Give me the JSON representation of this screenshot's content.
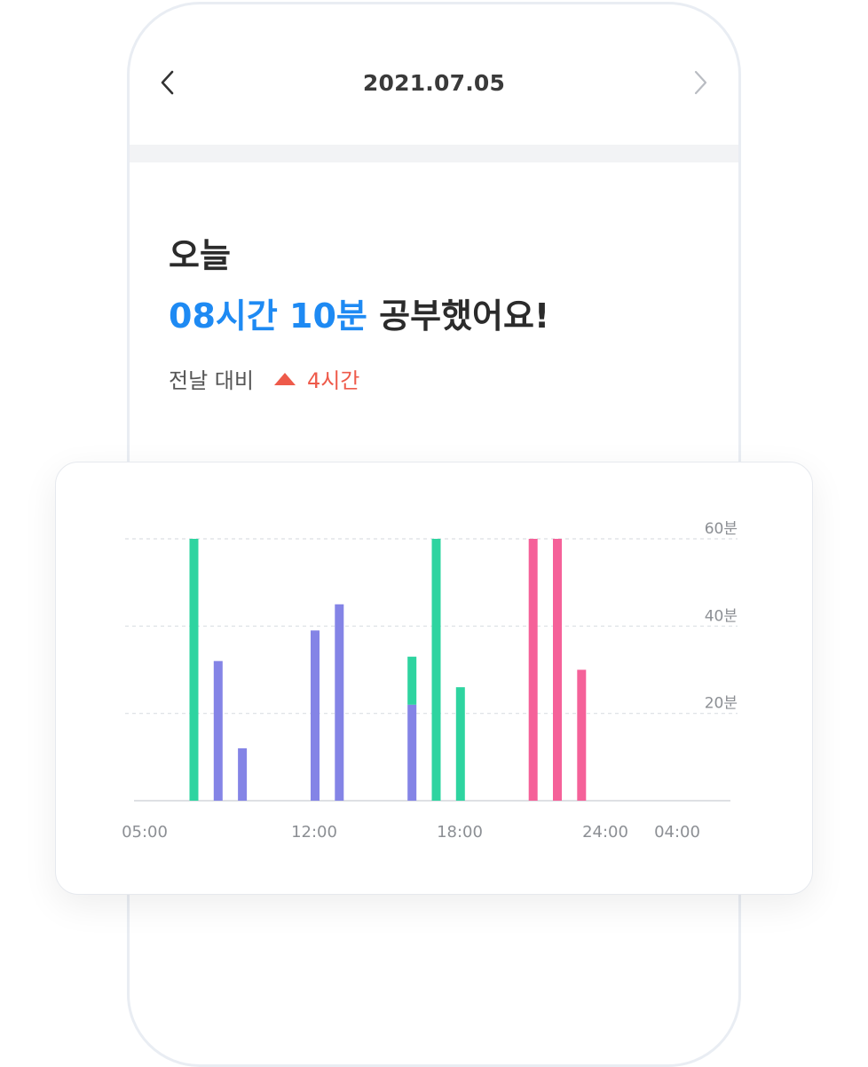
{
  "header": {
    "date": "2021.07.05",
    "prev_icon": "chevron-left-icon",
    "next_icon": "chevron-right-icon"
  },
  "summary": {
    "today_label": "오늘",
    "study_time": "08시간 10분",
    "study_suffix": "공부했어요!",
    "compare_label": "전날 대비",
    "compare_icon": "triangle-up-icon",
    "compare_value": "4시간"
  },
  "colors": {
    "accent": "#1e8af3",
    "increase": "#ee5a4a",
    "green": "#2ed4a0",
    "purple": "#8484e6",
    "pink": "#f56199"
  },
  "chart_data": {
    "type": "bar",
    "ylim": [
      0,
      60
    ],
    "y_ticks": [
      {
        "value": 60,
        "label": "60분"
      },
      {
        "value": 40,
        "label": "40분"
      },
      {
        "value": 20,
        "label": "20분"
      }
    ],
    "x_ticks": [
      {
        "hour": 5,
        "label": "05:00"
      },
      {
        "hour": 12,
        "label": "12:00"
      },
      {
        "hour": 18,
        "label": "18:00"
      },
      {
        "hour": 24,
        "label": "24:00"
      },
      {
        "hour": 27,
        "label": "04:00"
      }
    ],
    "xlim": [
      5,
      29
    ],
    "bars": [
      {
        "hour": 7,
        "segments": [
          {
            "color": "green",
            "value": 60
          }
        ]
      },
      {
        "hour": 8,
        "segments": [
          {
            "color": "purple",
            "value": 32
          }
        ]
      },
      {
        "hour": 9,
        "segments": [
          {
            "color": "purple",
            "value": 12
          }
        ]
      },
      {
        "hour": 12,
        "segments": [
          {
            "color": "purple",
            "value": 39
          }
        ]
      },
      {
        "hour": 13,
        "segments": [
          {
            "color": "purple",
            "value": 45
          }
        ]
      },
      {
        "hour": 16,
        "segments": [
          {
            "color": "purple",
            "value": 22
          },
          {
            "color": "green",
            "value": 11
          }
        ]
      },
      {
        "hour": 17,
        "segments": [
          {
            "color": "green",
            "value": 60
          }
        ]
      },
      {
        "hour": 18,
        "segments": [
          {
            "color": "green",
            "value": 26
          }
        ]
      },
      {
        "hour": 21,
        "segments": [
          {
            "color": "pink",
            "value": 60
          }
        ]
      },
      {
        "hour": 22,
        "segments": [
          {
            "color": "pink",
            "value": 60
          }
        ]
      },
      {
        "hour": 23,
        "segments": [
          {
            "color": "pink",
            "value": 30
          }
        ]
      }
    ]
  }
}
